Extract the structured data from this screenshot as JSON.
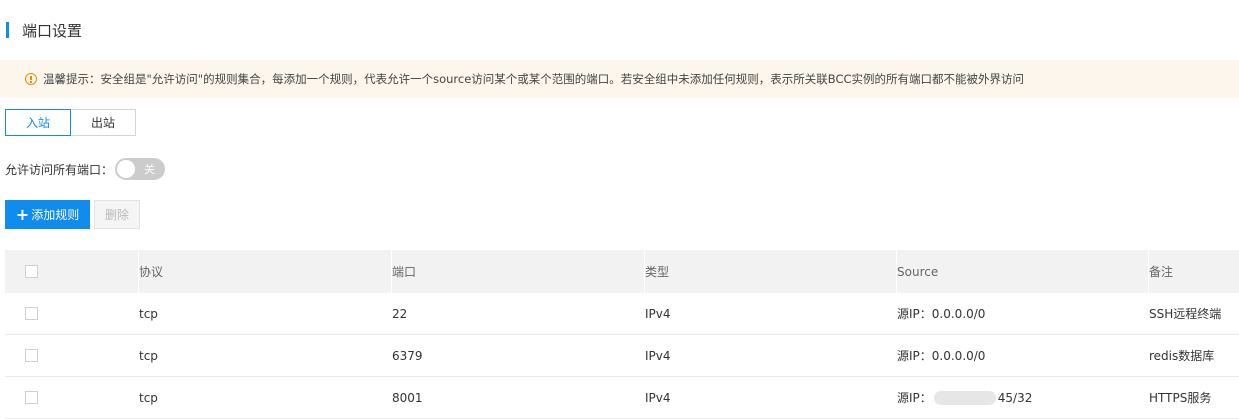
{
  "section": {
    "title": "端口设置"
  },
  "notice": {
    "text": "温馨提示：安全组是\"允许访问\"的规则集合，每添加一个规则，代表允许一个source访问某个或某个范围的端口。若安全组中未添加任何规则，表示所关联BCC实例的所有端口都不能被外界访问",
    "accent_color": "#f38900",
    "background": "#fcf6ed"
  },
  "tabs": [
    {
      "label": "入站",
      "active": true
    },
    {
      "label": "出站",
      "active": false
    }
  ],
  "allow_all": {
    "label": "允许访问所有端口：",
    "switch_text": "关",
    "on": false
  },
  "toolbar": {
    "add_label": "添加规则",
    "delete_label": "删除",
    "add_icon": "plus-icon"
  },
  "table": {
    "headers": {
      "protocol": "协议",
      "port": "端口",
      "type": "类型",
      "source": "Source",
      "note": "备注"
    },
    "rows": [
      {
        "protocol": "tcp",
        "port": "22",
        "type": "IPv4",
        "source_prefix": "源IP：",
        "source_value": "0.0.0.0/0",
        "note": "SSH远程终端"
      },
      {
        "protocol": "tcp",
        "port": "6379",
        "type": "IPv4",
        "source_prefix": "源IP：",
        "source_value": "0.0.0.0/0",
        "note": "redis数据库"
      },
      {
        "protocol": "tcp",
        "port": "8001",
        "type": "IPv4",
        "source_prefix": "源IP：",
        "source_value": "45/32",
        "note": "HTTPS服务"
      }
    ]
  },
  "colors": {
    "primary": "#108cee",
    "header_bg": "#f2f2f2"
  }
}
